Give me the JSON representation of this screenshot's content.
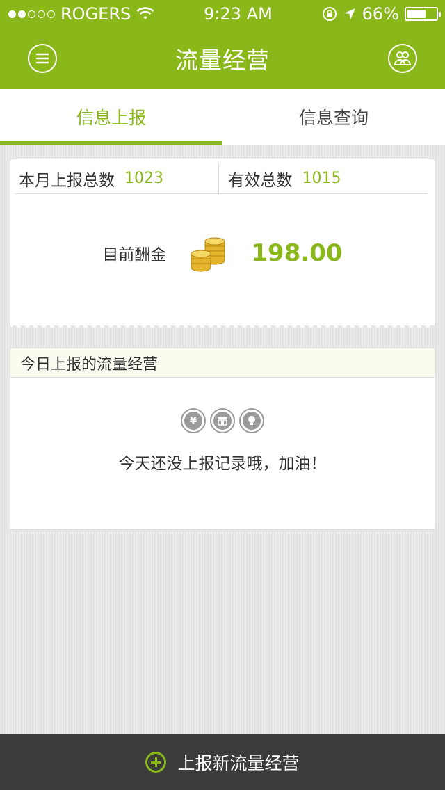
{
  "status": {
    "carrier": "ROGERS",
    "time": "9:23 AM",
    "battery": "66%",
    "battery_level": 0.66,
    "signal_bars_filled": 2,
    "signal_bars_total": 5
  },
  "header": {
    "title": "流量经营",
    "menu_icon": "menu-icon",
    "profile_icon": "user-group-icon"
  },
  "tabs": [
    {
      "label": "信息上报",
      "active": true
    },
    {
      "label": "信息查询",
      "active": false
    }
  ],
  "summary": {
    "monthly_label": "本月上报总数",
    "monthly_value": "1023",
    "valid_label": "有效总数",
    "valid_value": "1015",
    "reward_label": "目前酬金",
    "reward_value": "198.00",
    "reward_icon": "coins-icon"
  },
  "today": {
    "title": "今日上报的流量经营",
    "icons": [
      "yuan-icon",
      "shop-icon",
      "lightbulb-icon"
    ],
    "empty_message": "今天还没上报记录哦，加油！"
  },
  "footer": {
    "add_label": "上报新流量经营",
    "add_icon": "plus-circle-icon"
  },
  "colors": {
    "brand": "#8ab81a",
    "footer_bg": "#3b3b3b"
  }
}
